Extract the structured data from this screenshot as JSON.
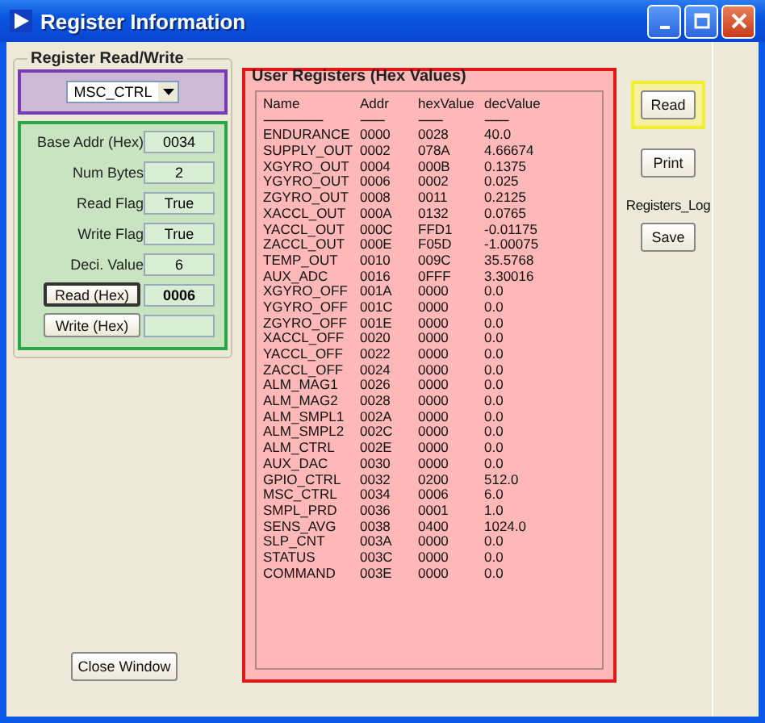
{
  "window": {
    "title": "Register Information"
  },
  "register_rw": {
    "title": "Register Read/Write",
    "register_select": {
      "value": "MSC_CTRL"
    },
    "fields": [
      {
        "kind": "field",
        "label": "Base Addr (Hex)",
        "value": "0034",
        "bold": false
      },
      {
        "kind": "field",
        "label": "Num Bytes",
        "value": "2",
        "bold": false
      },
      {
        "kind": "field",
        "label": "Read Flag",
        "value": "True",
        "bold": false
      },
      {
        "kind": "field",
        "label": "Write Flag",
        "value": "True",
        "bold": false
      },
      {
        "kind": "field",
        "label": "Deci. Value",
        "value": "6",
        "bold": false
      },
      {
        "kind": "action",
        "label": "Read (Hex)",
        "value": "0006",
        "bold": true
      },
      {
        "kind": "action",
        "label": "Write (Hex)"
      }
    ]
  },
  "close_button": "Close Window",
  "user_registers": {
    "title": "User Registers (Hex Values)",
    "columns": [
      "Name",
      "Addr",
      "hexValue",
      "decValue"
    ],
    "separators": [
      "--------------------",
      "--------",
      "--------",
      "--------"
    ],
    "rows": [
      [
        "ENDURANCE",
        "0000",
        "0028",
        "40.0"
      ],
      [
        "SUPPLY_OUT",
        "0002",
        "078A",
        "4.66674"
      ],
      [
        "XGYRO_OUT",
        "0004",
        "000B",
        "0.1375"
      ],
      [
        "YGYRO_OUT",
        "0006",
        "0002",
        "0.025"
      ],
      [
        "ZGYRO_OUT",
        "0008",
        "0011",
        "0.2125"
      ],
      [
        "XACCL_OUT",
        "000A",
        "0132",
        "0.0765"
      ],
      [
        "YACCL_OUT",
        "000C",
        "FFD1",
        "-0.01175"
      ],
      [
        "ZACCL_OUT",
        "000E",
        "F05D",
        "-1.00075"
      ],
      [
        "TEMP_OUT",
        "0010",
        "009C",
        "35.5768"
      ],
      [
        "AUX_ADC",
        "0016",
        "0FFF",
        "3.30016"
      ],
      [
        "XGYRO_OFF",
        "001A",
        "0000",
        "0.0"
      ],
      [
        "YGYRO_OFF",
        "001C",
        "0000",
        "0.0"
      ],
      [
        "ZGYRO_OFF",
        "001E",
        "0000",
        "0.0"
      ],
      [
        "XACCL_OFF",
        "0020",
        "0000",
        "0.0"
      ],
      [
        "YACCL_OFF",
        "0022",
        "0000",
        "0.0"
      ],
      [
        "ZACCL_OFF",
        "0024",
        "0000",
        "0.0"
      ],
      [
        "ALM_MAG1",
        "0026",
        "0000",
        "0.0"
      ],
      [
        "ALM_MAG2",
        "0028",
        "0000",
        "0.0"
      ],
      [
        "ALM_SMPL1",
        "002A",
        "0000",
        "0.0"
      ],
      [
        "ALM_SMPL2",
        "002C",
        "0000",
        "0.0"
      ],
      [
        "ALM_CTRL",
        "002E",
        "0000",
        "0.0"
      ],
      [
        "AUX_DAC",
        "0030",
        "0000",
        "0.0"
      ],
      [
        "GPIO_CTRL",
        "0032",
        "0200",
        "512.0"
      ],
      [
        "MSC_CTRL",
        "0034",
        "0006",
        "6.0"
      ],
      [
        "SMPL_PRD",
        "0036",
        "0001",
        "1.0"
      ],
      [
        "SENS_AVG",
        "0038",
        "0400",
        "1024.0"
      ],
      [
        "SLP_CNT",
        "003A",
        "0000",
        "0.0"
      ],
      [
        "STATUS",
        "003C",
        "0000",
        "0.0"
      ],
      [
        "COMMAND",
        "003E",
        "0000",
        "0.0"
      ]
    ]
  },
  "actions": [
    {
      "kind": "button",
      "text": "Read",
      "highlighted": true
    },
    {
      "kind": "button",
      "text": "Print",
      "highlighted": false
    },
    {
      "kind": "label",
      "text": "Registers_Log"
    },
    {
      "kind": "button",
      "text": "Save",
      "highlighted": false
    }
  ]
}
